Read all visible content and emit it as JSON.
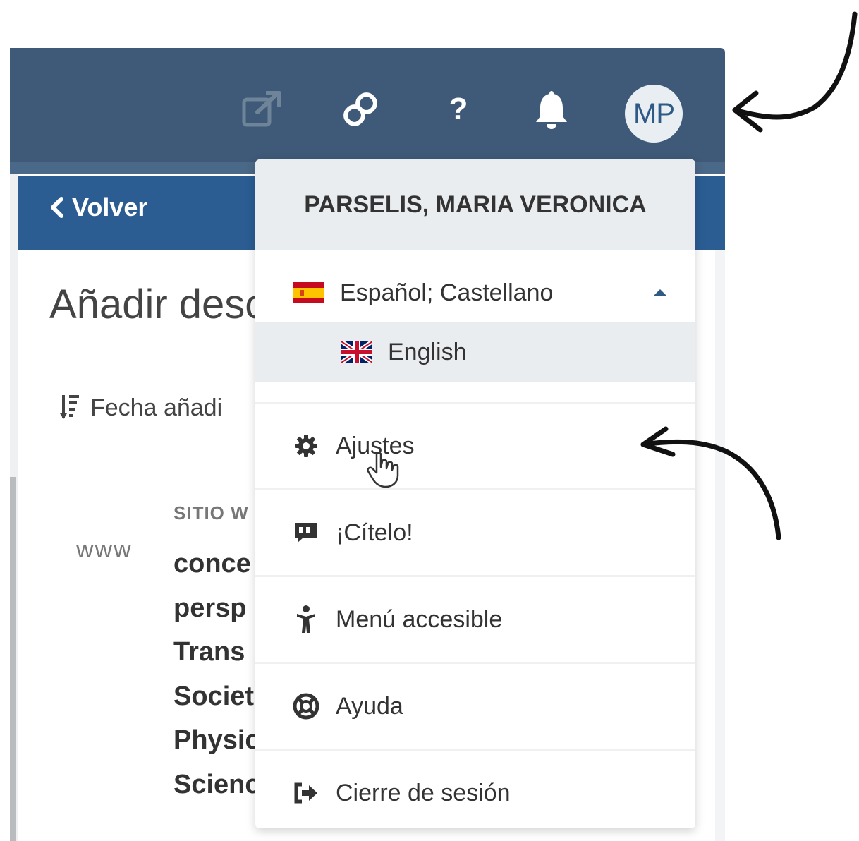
{
  "header": {
    "avatar_initials": "MP",
    "icons": [
      "external-link-icon",
      "chain-link-icon",
      "help-icon",
      "bell-icon"
    ],
    "help_glyph": "?"
  },
  "page": {
    "back_label": "Volver",
    "title": "Añadir desc",
    "sort_label": "Fecha añadi",
    "item": {
      "type_label": "www",
      "kind_label": "SITIO W",
      "lines": [
        "conce",
        "persp",
        "Trans",
        "Societ",
        "Physic",
        "Scienc"
      ]
    }
  },
  "dropdown": {
    "user_name": "PARSELIS, MARIA VERONICA",
    "languages": [
      {
        "label": "Español; Castellano",
        "flag": "spain-flag-icon",
        "selected": true
      },
      {
        "label": "English",
        "flag": "uk-flag-icon",
        "selected": false
      }
    ],
    "menu": [
      {
        "label": "Ajustes",
        "icon": "gear-icon"
      },
      {
        "label": "¡Cítelo!",
        "icon": "cite-icon"
      },
      {
        "label": "Menú accesible",
        "icon": "accessibility-icon"
      },
      {
        "label": "Ayuda",
        "icon": "lifebuoy-icon"
      },
      {
        "label": "Cierre de sesión",
        "icon": "sign-out-icon"
      }
    ]
  },
  "colors": {
    "topbar": "#3e5a78",
    "blue_bar": "#2b5d93",
    "accent": "#2f5a86"
  }
}
